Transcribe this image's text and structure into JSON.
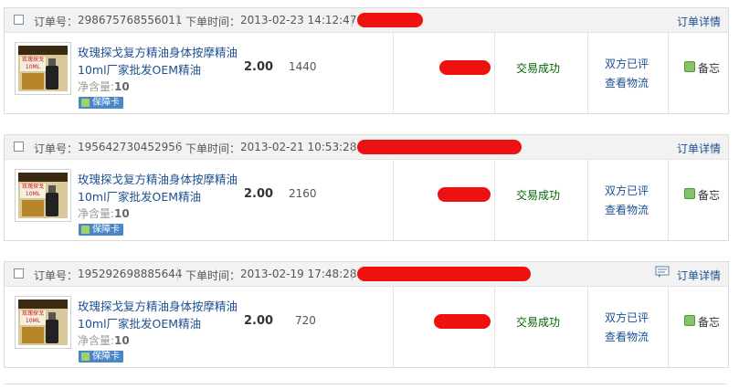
{
  "labels": {
    "order_no": "订单号：",
    "order_time": "下单时间：",
    "order_detail": "订单详情",
    "net_content": "净含量:",
    "guarantee_card": "保障卡",
    "memo": "备忘",
    "thumb_text": "玫瑰探戈 10ML"
  },
  "orders": [
    {
      "order_no": "298675768556011",
      "order_time": "2013-02-23 14:12:47",
      "title": "玫瑰探戈复方精油身体按摩精油10ml厂家批发OEM精油",
      "net_value": "10",
      "price": "2.00",
      "quantity": "1440",
      "status": "交易成功",
      "rating_status": "双方已评",
      "view_logistics": "查看物流",
      "has_message_icon": false
    },
    {
      "order_no": "195642730452956",
      "order_time": "2013-02-21 10:53:28",
      "title": "玫瑰探戈复方精油身体按摩精油10ml厂家批发OEM精油",
      "net_value": "10",
      "price": "2.00",
      "quantity": "2160",
      "status": "交易成功",
      "rating_status": "双方已评",
      "view_logistics": "查看物流",
      "has_message_icon": false
    },
    {
      "order_no": "195292698885644",
      "order_time": "2013-02-19 17:48:28",
      "title": "玫瑰探戈复方精油身体按摩精油10ml厂家批发OEM精油",
      "net_value": "10",
      "price": "2.00",
      "quantity": "720",
      "status": "交易成功",
      "rating_status": "双方已评",
      "view_logistics": "查看物流",
      "has_message_icon": true
    }
  ],
  "colors": {
    "link": "#1d4f91",
    "success": "#006400",
    "redaction": "#ee1111",
    "header_bg": "#f2f2f2"
  },
  "icons": {
    "checkbox": "checkbox-icon",
    "message": "message-icon",
    "memo": "memo-icon",
    "guarantee": "shield-icon"
  }
}
